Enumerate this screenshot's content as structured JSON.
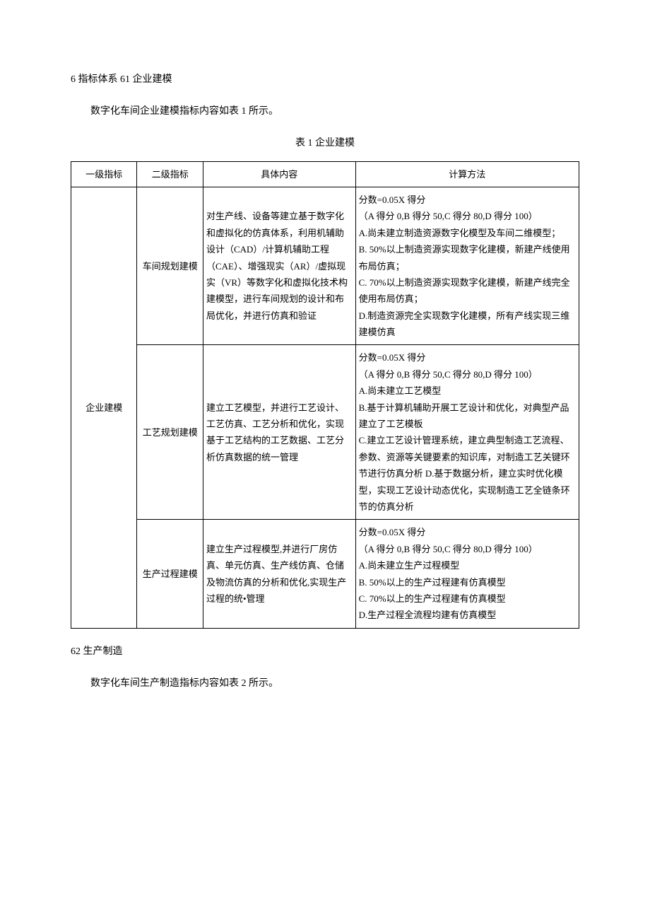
{
  "heading1": "6 指标体系 61 企业建模",
  "intro1": "数字化车间企业建模指标内容如表 1 所示。",
  "caption1": "表 1 企业建模",
  "th": {
    "c1": "一级指标",
    "c2": "二级指标",
    "c3": "具体内容",
    "c4": "计算方法"
  },
  "level1": "企业建模",
  "rows": [
    {
      "c2": "车间规划建模",
      "c3": "对生产线、设备等建立基于数字化和虚拟化的仿真体系，利用机辅助设计（CAD）/计算机辅助工程（CAE）、增强现实（AR）/虚拟现实（VR）等数字化和虚拟化技术构建模型，进行车间规划的设计和布局优化，并进行仿真和验证",
      "c4": "分数=0.05X 得分\n（A 得分 0,B 得分 50,C 得分 80,D 得分 100）\nA.尚未建立制造资源数字化模型及车间二维模型；\nB. 50%以上制造资源实现数字化建模，新建产线使用布局仿真；\nC. 70%以上制造资源实现数字化建模，新建产线完全使用布局仿真；\nD.制造资源完全实现数字化建模，所有产线实现三维建模仿真"
    },
    {
      "c2": "工艺规划建模",
      "c3": "建立工艺模型，并进行工艺设计、工艺仿真、工艺分析和优化，实现基于工艺结构的工艺数据、工艺分析仿真数据的统一管理",
      "c4": "分数=0.05X 得分\n（A 得分 0,B 得分 50,C 得分 80,D 得分 100）\nA.尚未建立工艺模型\nB.基于计算机辅助开展工艺设计和优化，对典型产品建立了工艺模板\nC.建立工艺设计管理系统，建立典型制造工艺流程、参数、资源等关键要素的知识库，对制造工艺关键环节进行仿真分析 D.基于数据分析，建立实时优化模型，实现工艺设计动态优化，实现制造工艺全链条环节的仿真分析"
    },
    {
      "c2": "生产过程建模",
      "c3": "建立生产过程模型,并进行厂房仿真、单元仿真、生产线仿真、仓储及物流仿真的分析和优化,实现生产过程的统•管理",
      "c4": "分数=0.05X 得分\n（A 得分 0,B 得分 50,C 得分 80,D 得分 100）\nA.尚未建立生产过程模型\nB. 50%以上的生产过程建有仿真模型\nC. 70%以上的生产过程建有仿真模型\nD.生产过程全流程均建有仿真模型"
    }
  ],
  "heading2": "62 生产制造",
  "intro2": "数字化车间生产制造指标内容如表 2 所示。"
}
